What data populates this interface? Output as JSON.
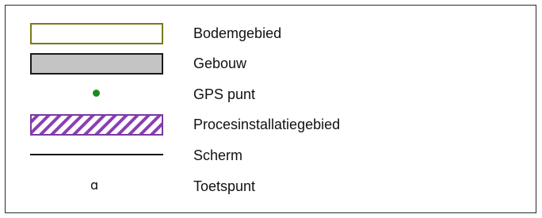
{
  "legend": {
    "items": [
      {
        "label": "Bodemgebied",
        "symbol": "outlined-rectangle",
        "stroke": "#7a7a18",
        "fill": "#ffffff"
      },
      {
        "label": "Gebouw",
        "symbol": "filled-rectangle",
        "stroke": "#1a1a1a",
        "fill": "#c4c4c4"
      },
      {
        "label": "GPS punt",
        "symbol": "dot",
        "fill": "#1f8a1f"
      },
      {
        "label": "Procesinstallatiegebied",
        "symbol": "hatched-rectangle",
        "stroke": "#7a3aa0",
        "hatch": "#8a3fb5"
      },
      {
        "label": "Scherm",
        "symbol": "line",
        "stroke": "#111111"
      },
      {
        "label": "Toetspunt",
        "symbol": "test-point-glyph",
        "glyph": "ɑ"
      }
    ]
  }
}
